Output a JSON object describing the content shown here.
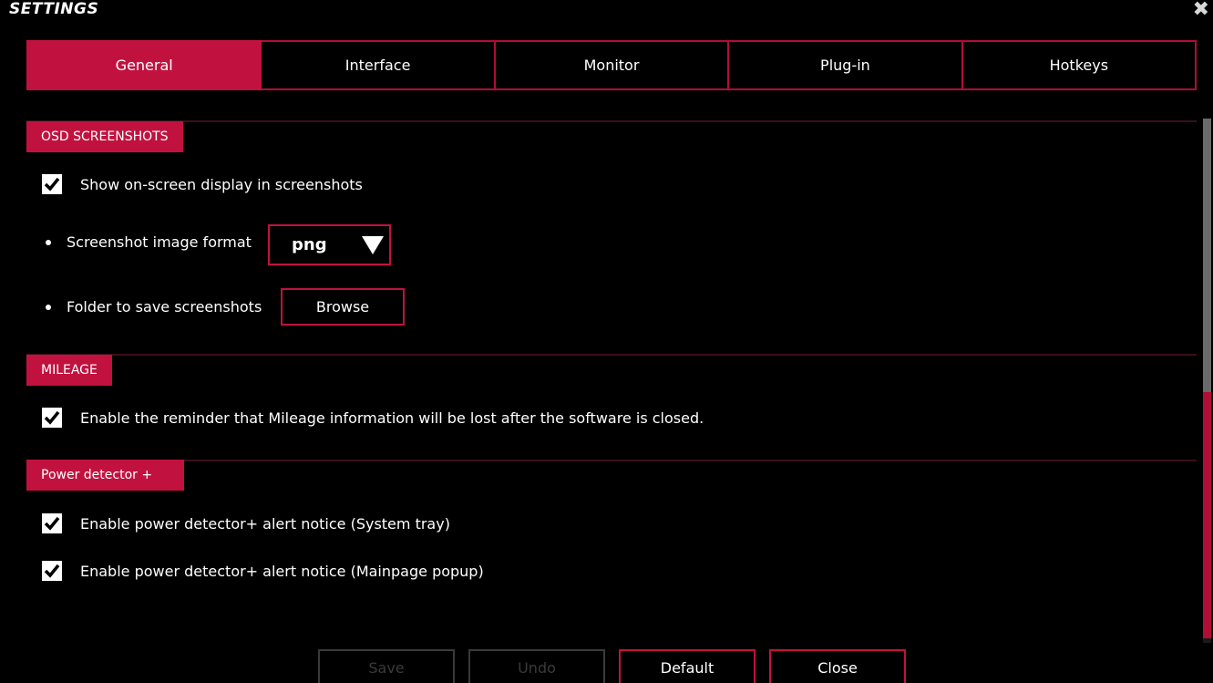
{
  "window": {
    "title": "SETTINGS",
    "close_glyph": "✖"
  },
  "tabs": [
    {
      "label": "General",
      "active": true
    },
    {
      "label": "Interface",
      "active": false
    },
    {
      "label": "Monitor",
      "active": false
    },
    {
      "label": "Plug-in",
      "active": false
    },
    {
      "label": "Hotkeys",
      "active": false
    }
  ],
  "sections": {
    "osd": {
      "label": "OSD SCREENSHOTS",
      "show_osd": {
        "label": "Show on-screen display in screenshots",
        "checked": true
      },
      "format": {
        "label": "Screenshot image format",
        "value": "png"
      },
      "folder": {
        "label": "Folder to save screenshots",
        "button": "Browse"
      }
    },
    "mileage": {
      "label": "MILEAGE",
      "reminder": {
        "label": "Enable the reminder that Mileage information will be lost after the software is closed.",
        "checked": true
      }
    },
    "power": {
      "label": "Power detector +",
      "tray": {
        "label": "Enable power detector+ alert notice (System tray)",
        "checked": true
      },
      "popup": {
        "label": "Enable power detector+ alert notice (Mainpage popup)",
        "checked": true
      }
    }
  },
  "footer": {
    "save": "Save",
    "undo": "Undo",
    "default": "Default",
    "close": "Close"
  },
  "colors": {
    "accent": "#c1123f",
    "background": "#000000"
  }
}
